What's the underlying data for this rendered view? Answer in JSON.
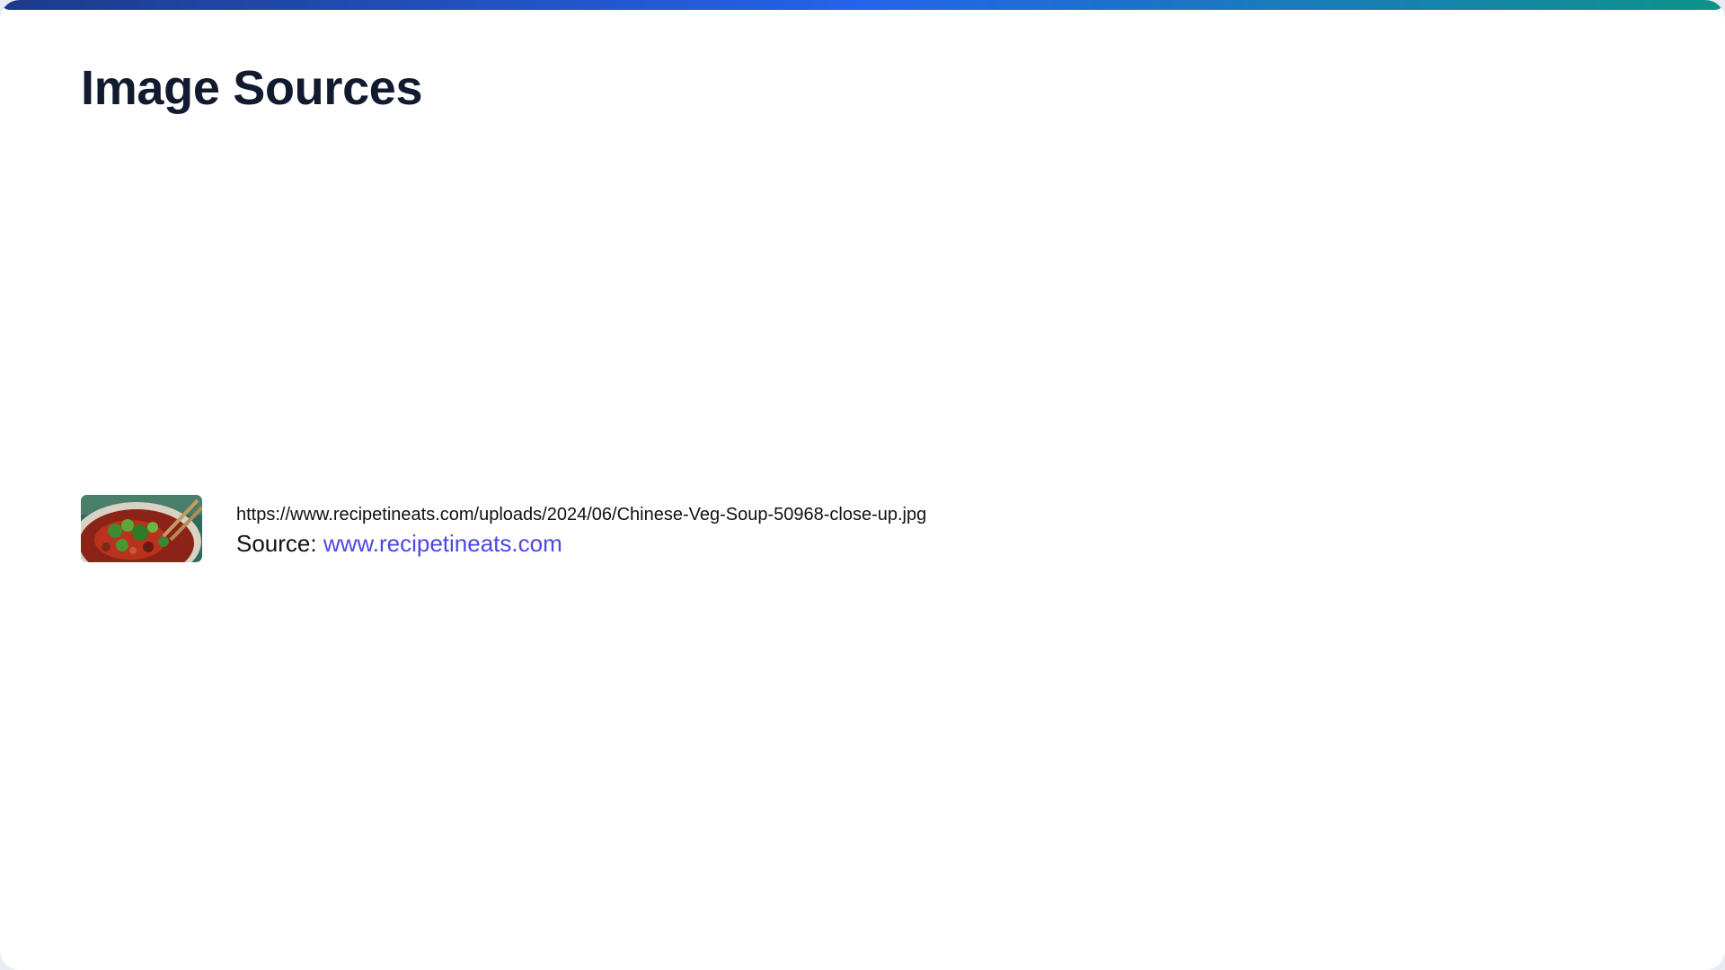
{
  "page": {
    "title": "Image Sources"
  },
  "sources": [
    {
      "thumbnail_icon": "soup-thumbnail-image",
      "url": "https://www.recipetineats.com/uploads/2024/06/Chinese-Veg-Soup-50968-close-up.jpg",
      "source_label": "Source:",
      "source_link_text": "www.recipetineats.com"
    }
  ],
  "colors": {
    "title": "#111a2e",
    "link": "#4f46e5",
    "accent_gradient_start": "#1e3a8a",
    "accent_gradient_mid": "#2563eb",
    "accent_gradient_end": "#0d9488"
  }
}
